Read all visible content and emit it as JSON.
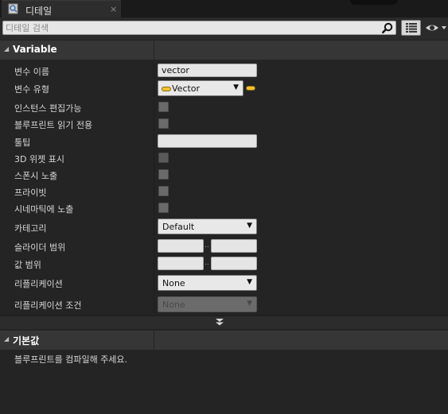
{
  "tab": {
    "title": "디테일",
    "close_symbol": "×"
  },
  "search": {
    "placeholder": "디테일 검색"
  },
  "sections": {
    "variable": {
      "title": "Variable"
    },
    "defaults": {
      "title": "기본값"
    }
  },
  "properties": {
    "var_name": {
      "label": "변수 이름",
      "value": "vector"
    },
    "var_type": {
      "label": "변수 유형",
      "value": "Vector"
    },
    "instance_editable": {
      "label": "인스턴스 편집가능"
    },
    "blueprint_readonly": {
      "label": "블루프린트 읽기 전용"
    },
    "tooltip": {
      "label": "툴팁",
      "value": ""
    },
    "widget_3d": {
      "label": "3D 위젯 표시"
    },
    "expose_spawn": {
      "label": "스폰시 노출"
    },
    "private": {
      "label": "프라이빗"
    },
    "expose_cinematics": {
      "label": "시네마틱에 노출"
    },
    "category": {
      "label": "카테고리",
      "value": "Default"
    },
    "slider_range": {
      "label": "슬라이더 범위"
    },
    "value_range": {
      "label": "값 범위"
    },
    "replication": {
      "label": "리플리케이션",
      "value": "None"
    },
    "replication_condition": {
      "label": "리플리케이션 조건",
      "value": "None"
    }
  },
  "defaults_note": "블루프린트를 컴파일해 주세요.",
  "colors": {
    "type_pill": "#f2c230",
    "panel_bg": "#242424",
    "header_bg": "#363636"
  }
}
